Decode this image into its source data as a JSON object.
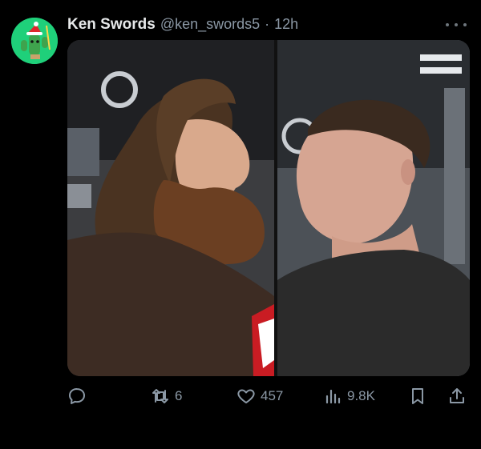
{
  "author": {
    "name": "Ken Swords",
    "handle": "@ken_swords5",
    "separator": "·",
    "time": "12h",
    "avatar_icon": "cactus-santa-avatar-icon"
  },
  "media": {
    "left_panel_icon": "before-haircut-photo",
    "right_panel_icon": "after-haircut-photo"
  },
  "actions": {
    "reply_count": "",
    "repost_count": "6",
    "like_count": "457",
    "views_count": "9.8K"
  },
  "colors": {
    "background": "#000000",
    "text": "#e7e9ea",
    "muted": "#8b98a5",
    "avatar_bg": "#1fd07a"
  }
}
